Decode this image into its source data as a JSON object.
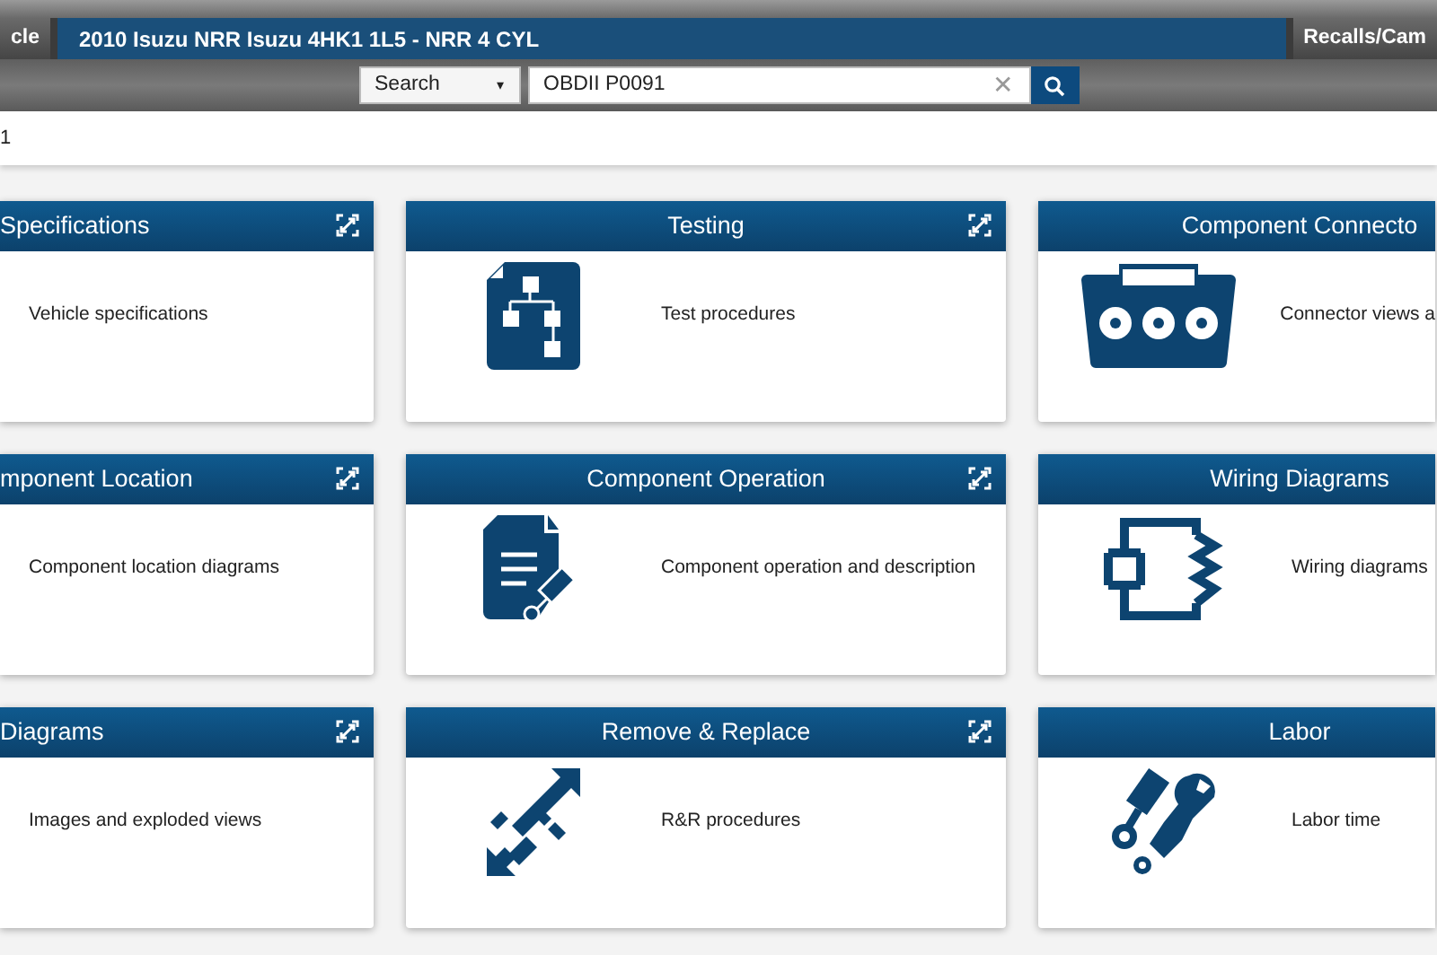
{
  "top_bar": {
    "left_button": "cle",
    "vehicle_title": "2010 Isuzu NRR Isuzu 4HK1 1L5 - NRR 4 CYL",
    "right_button": "Recalls/Cam"
  },
  "search": {
    "scope": "Search",
    "caret": "▾",
    "value": "OBDII P0091",
    "clear": "✕"
  },
  "breadcrumb": "1",
  "cards": [
    {
      "title": "Specifications",
      "description": "Vehicle specifications",
      "expandable": true
    },
    {
      "title": "Testing",
      "description": "Test procedures",
      "expandable": true
    },
    {
      "title": "Component Connecto",
      "description": "Connector views a",
      "expandable": false
    },
    {
      "title": "mponent Location",
      "description": "Component location diagrams",
      "expandable": true
    },
    {
      "title": "Component Operation",
      "description": "Component operation and description",
      "expandable": true
    },
    {
      "title": "Wiring Diagrams",
      "description": "Wiring diagrams",
      "expandable": false
    },
    {
      "title": "Diagrams",
      "description": "Images and exploded views",
      "expandable": true
    },
    {
      "title": "Remove & Replace",
      "description": "R&R procedures",
      "expandable": true
    },
    {
      "title": "Labor",
      "description": "Labor time",
      "expandable": false
    }
  ]
}
